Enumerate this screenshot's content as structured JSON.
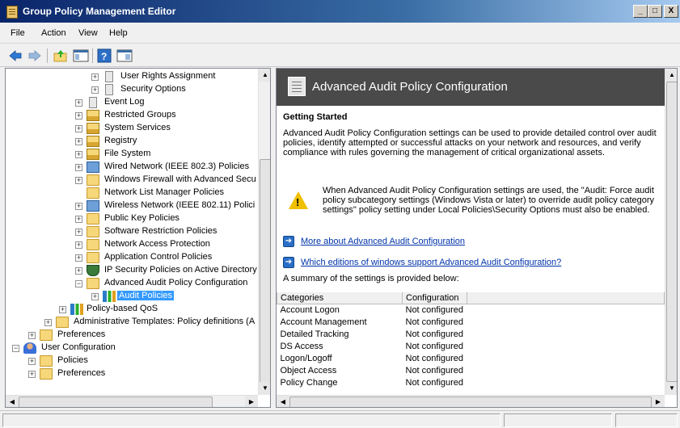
{
  "window": {
    "title": "Group Policy Management Editor",
    "minimize": "_",
    "maximize": "□",
    "close": "X"
  },
  "menu": {
    "file": "File",
    "action": "Action",
    "view": "View",
    "help": "Help"
  },
  "tree": {
    "items": [
      {
        "label": "User Rights Assignment",
        "icon": "doc-icon",
        "expander": "+"
      },
      {
        "label": "Security Options",
        "icon": "doc-icon",
        "expander": "+"
      },
      {
        "label": "Event Log",
        "icon": "doc-icon",
        "expander": "+"
      },
      {
        "label": "Restricted Groups",
        "icon": "lock-folder-icon",
        "expander": "+"
      },
      {
        "label": "System Services",
        "icon": "lock-folder-icon",
        "expander": "+"
      },
      {
        "label": "Registry",
        "icon": "lock-folder-icon",
        "expander": "+"
      },
      {
        "label": "File System",
        "icon": "lock-folder-icon",
        "expander": "+"
      },
      {
        "label": "Wired Network (IEEE 802.3) Policies",
        "icon": "network-icon",
        "expander": "+"
      },
      {
        "label": "Windows Firewall with Advanced Secu",
        "icon": "folder-icon",
        "expander": "+"
      },
      {
        "label": "Network List Manager Policies",
        "icon": "folder-icon",
        "expander": ""
      },
      {
        "label": "Wireless Network (IEEE 802.11) Polici",
        "icon": "network-icon",
        "expander": "+"
      },
      {
        "label": "Public Key Policies",
        "icon": "folder-icon",
        "expander": "+"
      },
      {
        "label": "Software Restriction Policies",
        "icon": "folder-icon",
        "expander": "+"
      },
      {
        "label": "Network Access Protection",
        "icon": "folder-icon",
        "expander": "+"
      },
      {
        "label": "Application Control Policies",
        "icon": "folder-icon",
        "expander": "+"
      },
      {
        "label": "IP Security Policies on Active Directory",
        "icon": "shield-icon",
        "expander": "+"
      },
      {
        "label": "Advanced Audit Policy Configuration",
        "icon": "folder-icon",
        "expander": "−"
      },
      {
        "label": "Audit Policies",
        "icon": "audit-icon",
        "expander": "+",
        "selected": true
      },
      {
        "label": "Policy-based QoS",
        "icon": "chart-icon",
        "expander": "+"
      },
      {
        "label": "Administrative Templates: Policy definitions (A",
        "icon": "folder-icon",
        "expander": "+"
      },
      {
        "label": "Preferences",
        "icon": "folder-icon",
        "expander": "+"
      },
      {
        "label": "User Configuration",
        "icon": "user-icon",
        "expander": "−"
      },
      {
        "label": "Policies",
        "icon": "folder-icon",
        "expander": "+"
      },
      {
        "label": "Preferences",
        "icon": "folder-icon",
        "expander": "+"
      }
    ]
  },
  "content": {
    "header_title": "Advanced Audit Policy Configuration",
    "getting_started": "Getting Started",
    "intro": "Advanced Audit Policy Configuration settings can be used to provide detailed control over audit policies, identify attempted or successful attacks on your network and resources, and verify compliance with rules governing the management of critical organizational assets.",
    "warning": "When Advanced Audit Policy Configuration settings are used, the \"Audit: Force audit policy subcategory settings (Windows Vista or later) to override audit policy category settings\" policy setting under Local Policies\\Security Options must also be enabled.",
    "link_more": "More about Advanced Audit Configuration",
    "link_editions": "Which editions of windows support Advanced Audit Configuration?",
    "summary": "A summary of the settings is provided below:",
    "table": {
      "headers": [
        "Categories",
        "Configuration"
      ],
      "rows": [
        [
          "Account Logon",
          "Not configured"
        ],
        [
          "Account Management",
          "Not configured"
        ],
        [
          "Detailed Tracking",
          "Not configured"
        ],
        [
          "DS Access",
          "Not configured"
        ],
        [
          "Logon/Logoff",
          "Not configured"
        ],
        [
          "Object Access",
          "Not configured"
        ],
        [
          "Policy Change",
          "Not configured"
        ]
      ]
    }
  },
  "colors": {
    "title_gradient_start": "#0a246a",
    "header_bg": "#4a4a4a",
    "selection": "#3399ff",
    "link": "#0033aa"
  }
}
